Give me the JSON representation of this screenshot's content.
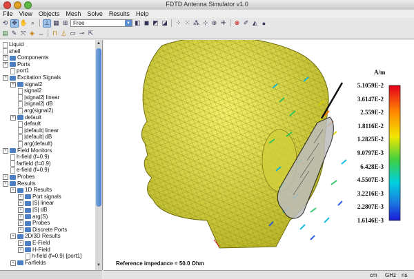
{
  "window": {
    "title": "FDTD Antenna Simulator v1.0"
  },
  "menu": [
    "File",
    "View",
    "Objects",
    "Mesh",
    "Solve",
    "Results",
    "Help"
  ],
  "toolbar": {
    "mode_select_value": "Free"
  },
  "tree": [
    {
      "label": "Liquid",
      "depth": 0,
      "type": "leaf"
    },
    {
      "label": "shell",
      "depth": 0,
      "type": "leaf"
    },
    {
      "label": "Components",
      "depth": 0,
      "type": "folder"
    },
    {
      "label": "Ports",
      "depth": 0,
      "type": "folder"
    },
    {
      "label": "port1",
      "depth": 1,
      "type": "leaf"
    },
    {
      "label": "Excitation Signals",
      "depth": 0,
      "type": "folder"
    },
    {
      "label": "signal2",
      "depth": 1,
      "type": "folder"
    },
    {
      "label": "signal2",
      "depth": 2,
      "type": "leaf"
    },
    {
      "label": "|signal2| linear",
      "depth": 2,
      "type": "leaf"
    },
    {
      "label": "|signal2| dB",
      "depth": 2,
      "type": "leaf"
    },
    {
      "label": "arg(signal2)",
      "depth": 2,
      "type": "leaf"
    },
    {
      "label": "default",
      "depth": 1,
      "type": "folder"
    },
    {
      "label": "default",
      "depth": 2,
      "type": "leaf"
    },
    {
      "label": "|default| linear",
      "depth": 2,
      "type": "leaf"
    },
    {
      "label": "|default| dB",
      "depth": 2,
      "type": "leaf"
    },
    {
      "label": "arg(default)",
      "depth": 2,
      "type": "leaf"
    },
    {
      "label": "Field Monitors",
      "depth": 0,
      "type": "folder"
    },
    {
      "label": "h-field (f=0.9)",
      "depth": 1,
      "type": "leaf"
    },
    {
      "label": "farfield (f=0.9)",
      "depth": 1,
      "type": "leaf"
    },
    {
      "label": "e-field (f=0.9)",
      "depth": 1,
      "type": "leaf"
    },
    {
      "label": "Probes",
      "depth": 0,
      "type": "folder"
    },
    {
      "label": "Results",
      "depth": 0,
      "type": "folder"
    },
    {
      "label": "1D Results",
      "depth": 1,
      "type": "folder"
    },
    {
      "label": "Port signals",
      "depth": 2,
      "type": "folder"
    },
    {
      "label": "|S| linear",
      "depth": 2,
      "type": "folder"
    },
    {
      "label": "|S| dB",
      "depth": 2,
      "type": "folder"
    },
    {
      "label": "arg(S)",
      "depth": 2,
      "type": "folder"
    },
    {
      "label": "Probes",
      "depth": 2,
      "type": "folder"
    },
    {
      "label": "Discrete Ports",
      "depth": 2,
      "type": "folder"
    },
    {
      "label": "2D/3D Results",
      "depth": 1,
      "type": "folder"
    },
    {
      "label": "E-Field",
      "depth": 2,
      "type": "folder"
    },
    {
      "label": "H-Field",
      "depth": 2,
      "type": "folder"
    },
    {
      "label": "h-field (f=0.9) [port1]",
      "depth": 3,
      "type": "leaf"
    },
    {
      "label": "Farfields",
      "depth": 1,
      "type": "folder"
    }
  ],
  "view": {
    "legend_unit": "A/m",
    "legend_ticks": [
      "5.1059E-2",
      "3.6147E-2",
      "2.559E-2",
      "1.8116E-2",
      "1.2825E-2",
      "9.0797E-3",
      "6.428E-3",
      "4.5507E-3",
      "3.2216E-3",
      "2.2807E-3",
      "1.6146E-3"
    ],
    "reference_impedance": "Reference impedance = 50.0 Ohm"
  },
  "status_units": [
    "cm",
    "GHz",
    "ns"
  ]
}
